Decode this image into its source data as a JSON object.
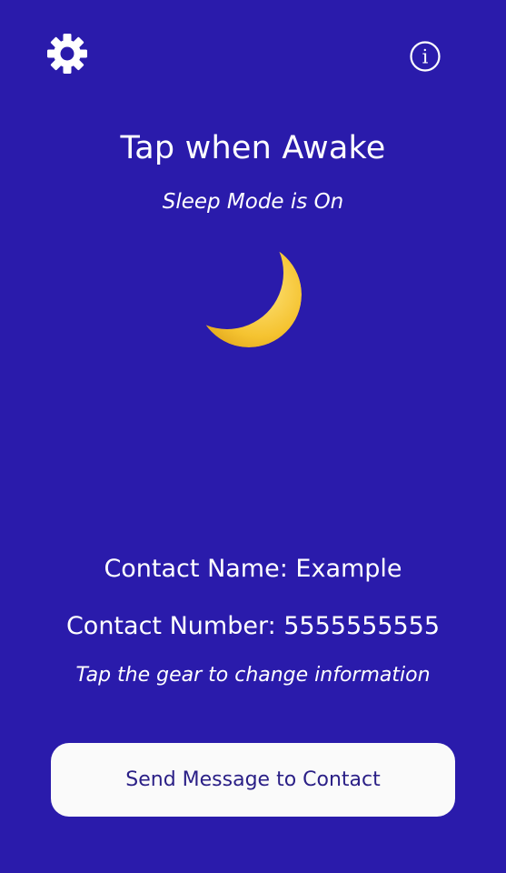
{
  "header": {
    "settings_icon": "gear-icon",
    "info_icon": "info-icon",
    "info_glyph": "i"
  },
  "main": {
    "title": "Tap when Awake",
    "subtitle": "Sleep Mode is On",
    "status_icon": "crescent-moon-icon"
  },
  "contact": {
    "name_text": "Contact Name: Example",
    "number_text": "Contact Number: 5555555555",
    "hint": "Tap the gear to change information"
  },
  "actions": {
    "send_label": "Send Message to Contact"
  },
  "colors": {
    "background": "#2a1bab",
    "button_background": "#fafafa",
    "button_text": "#2a1f86",
    "moon": "#f5c330"
  }
}
